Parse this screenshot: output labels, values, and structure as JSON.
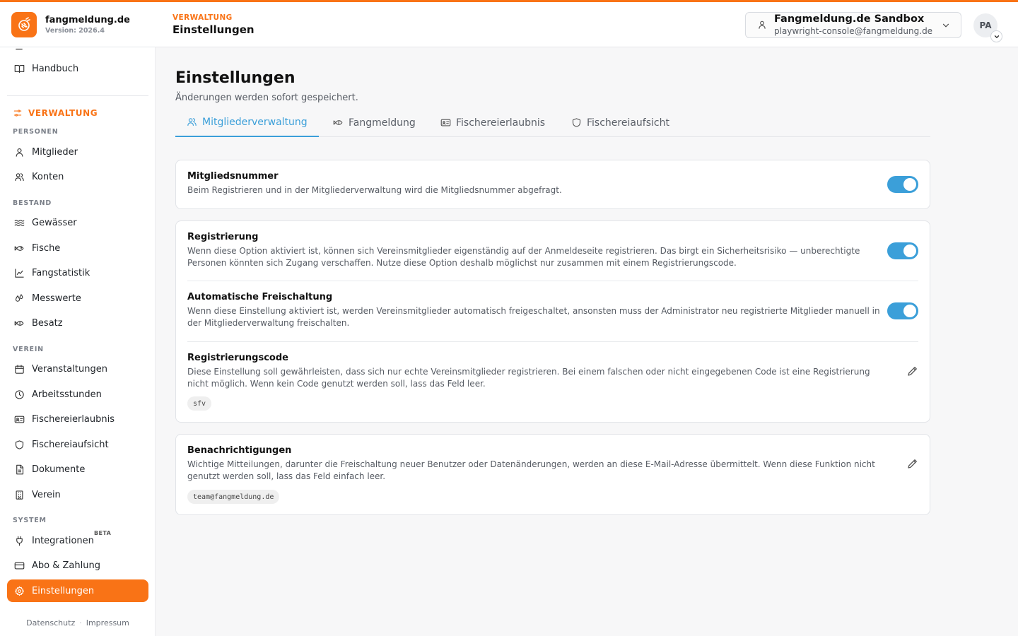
{
  "brand": {
    "name": "fangmeldung.de",
    "version": "Version: 2026.4",
    "accent": "#f97316"
  },
  "header": {
    "section": "VERWALTUNG",
    "title": "Einstellungen",
    "tenant_name": "Fangmeldung.de Sandbox",
    "tenant_email": "playwright-console@fangmeldung.de",
    "avatar": "PA"
  },
  "sidebar": {
    "top_item": "Handbuch",
    "section": "VERWALTUNG",
    "groups": {
      "personen": "PERSONEN",
      "bestand": "BESTAND",
      "verein": "VEREIN",
      "system": "SYSTEM"
    },
    "items": {
      "mitglieder": "Mitglieder",
      "konten": "Konten",
      "gewaesser": "Gewässer",
      "fische": "Fische",
      "fangstatistik": "Fangstatistik",
      "messwerte": "Messwerte",
      "besatz": "Besatz",
      "veranstaltungen": "Veranstaltungen",
      "arbeitsstunden": "Arbeitsstunden",
      "fischereierlaubnis": "Fischereierlaubnis",
      "fischereiaufsicht": "Fischereiaufsicht",
      "dokumente": "Dokumente",
      "verein": "Verein",
      "integrationen": "Integrationen",
      "abo": "Abo & Zahlung",
      "einstellungen": "Einstellungen"
    },
    "beta_badge": "BETA",
    "footer": {
      "privacy": "Datenschutz",
      "separator": "·",
      "imprint": "Impressum"
    }
  },
  "page": {
    "title": "Einstellungen",
    "subtitle": "Änderungen werden sofort gespeichert.",
    "tabs": {
      "members": "Mitgliederverwaltung",
      "catch": "Fangmeldung",
      "permit": "Fischereierlaubnis",
      "supervision": "Fischereiaufsicht"
    },
    "active_tab_color": "#3b9fd9"
  },
  "settings": {
    "member_number": {
      "title": "Mitgliedsnummer",
      "description": "Beim Registrieren und in der Mitgliederverwaltung wird die Mitgliedsnummer abgefragt.",
      "enabled": true
    },
    "registration": {
      "title": "Registrierung",
      "description": "Wenn diese Option aktiviert ist, können sich Vereinsmitglieder eigenständig auf der Anmeldeseite registrieren. Das birgt ein Sicherheitsrisiko — unberechtigte Personen könnten sich Zugang verschaffen. Nutze diese Option deshalb möglichst nur zusammen mit einem Registrierungscode.",
      "enabled": true
    },
    "auto_unlock": {
      "title": "Automatische Freischaltung",
      "description": "Wenn diese Einstellung aktiviert ist, werden Vereinsmitglieder automatisch freigeschaltet, ansonsten muss der Administrator neu registrierte Mitglieder manuell in der Mitgliederverwaltung freischalten.",
      "enabled": true
    },
    "registration_code": {
      "title": "Registrierungscode",
      "description": "Diese Einstellung soll gewährleisten, dass sich nur echte Vereinsmitglieder registrieren. Bei einem falschen oder nicht eingegebenen Code ist eine Registrierung nicht möglich. Wenn kein Code genutzt werden soll, lass das Feld leer.",
      "value": "sfv"
    },
    "notifications": {
      "title": "Benachrichtigungen",
      "description": "Wichtige Mitteilungen, darunter die Freischaltung neuer Benutzer oder Datenänderungen, werden an diese E-Mail-Adresse übermittelt. Wenn diese Funktion nicht genutzt werden soll, lass das Feld einfach leer.",
      "value": "team@fangmeldung.de"
    }
  }
}
